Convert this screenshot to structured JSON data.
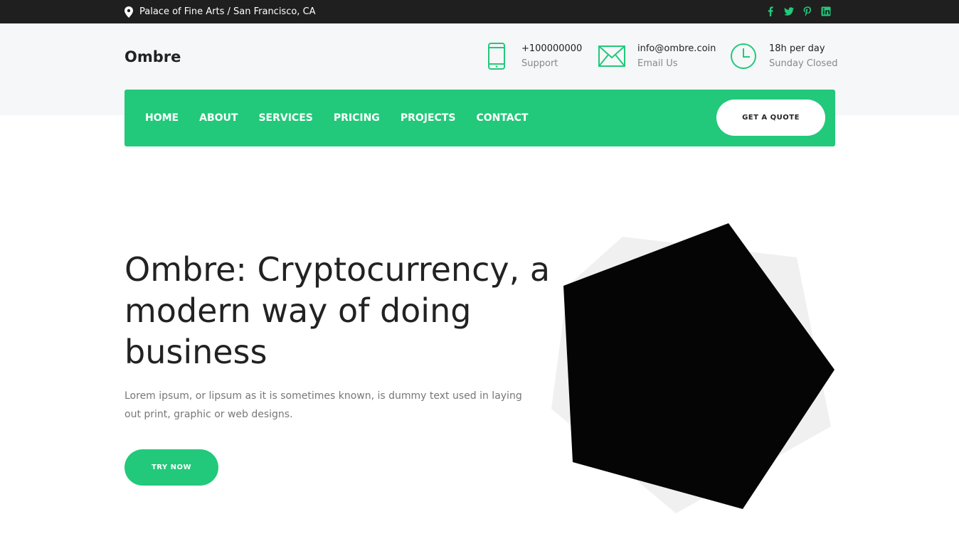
{
  "topbar": {
    "location": "Palace of Fine Arts / San Francisco, CA",
    "social_icons": [
      "facebook-icon",
      "twitter-icon",
      "pinterest-icon",
      "linkedin-icon"
    ]
  },
  "header": {
    "logo": "Ombre",
    "phone": {
      "value": "+100000000",
      "label": "Support",
      "icon": "phone-icon"
    },
    "email": {
      "value": "info@ombre.coin",
      "label": "Email Us",
      "icon": "mail-icon"
    },
    "hours": {
      "value": "18h per day",
      "label": "Sunday Closed",
      "icon": "clock-icon"
    }
  },
  "nav": {
    "items": [
      {
        "label": "HOME"
      },
      {
        "label": "ABOUT"
      },
      {
        "label": "SERVICES"
      },
      {
        "label": "PRICING"
      },
      {
        "label": "PROJECTS"
      },
      {
        "label": "CONTACT"
      }
    ],
    "quote_label": "GET A QUOTE"
  },
  "hero": {
    "title": "Ombre: Cryptocurrency, a modern way of doing business",
    "text": "Lorem ipsum, or lipsum as it is sometimes known, is dummy text used in laying out print, graphic or web designs.",
    "button_label": "TRY NOW"
  },
  "colors": {
    "accent": "#22c97a",
    "topbar": "#1f1f1f",
    "header_bg": "#f6f7f9",
    "shape_fill": "#050505",
    "shape_back": "#f0f0f0"
  }
}
